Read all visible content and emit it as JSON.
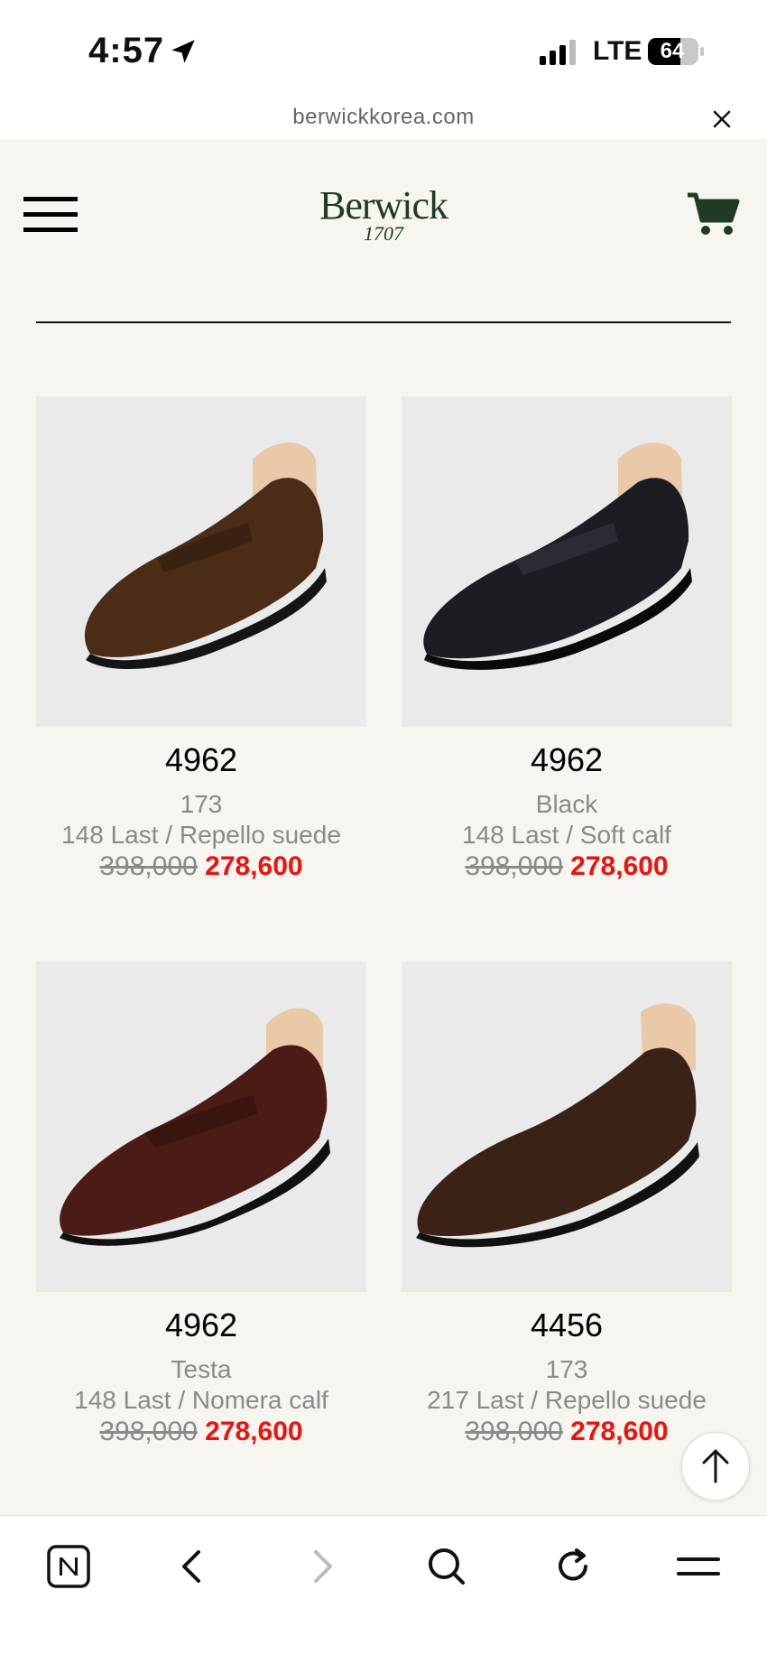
{
  "status_bar": {
    "time": "4:57",
    "network": "LTE",
    "battery": "64",
    "icons": [
      "location-arrow-icon",
      "signal-icon",
      "battery-icon"
    ]
  },
  "browser": {
    "url": "berwickkorea.com",
    "close_icon": "close-icon",
    "toolbar_icons": [
      "naver-icon",
      "back-icon",
      "forward-icon",
      "search-icon",
      "refresh-icon",
      "menu-icon"
    ]
  },
  "header": {
    "logo_name": "Berwick",
    "logo_year": "1707",
    "menu_icon": "hamburger-menu-icon",
    "cart_icon": "cart-icon"
  },
  "products": [
    {
      "model": "4962",
      "color": "173",
      "spec": "148 Last / Repello suede",
      "old_price": "398,000",
      "new_price": "278,600",
      "image": "dark-brown-suede-penny-loafer"
    },
    {
      "model": "4962",
      "color": "Black",
      "spec": "148 Last / Soft calf",
      "old_price": "398,000",
      "new_price": "278,600",
      "image": "black-calf-penny-loafer"
    },
    {
      "model": "4962",
      "color": "Testa",
      "spec": "148 Last / Nomera calf",
      "old_price": "398,000",
      "new_price": "278,600",
      "image": "burgundy-calf-penny-loafer"
    },
    {
      "model": "4456",
      "color": "173",
      "spec": "217 Last / Repello suede",
      "old_price": "398,000",
      "new_price": "278,600",
      "image": "dark-brown-suede-loafer"
    }
  ],
  "colors": {
    "accent_price": "#e8140f",
    "logo": "#1f3a25",
    "background": "#f7f5ef"
  }
}
